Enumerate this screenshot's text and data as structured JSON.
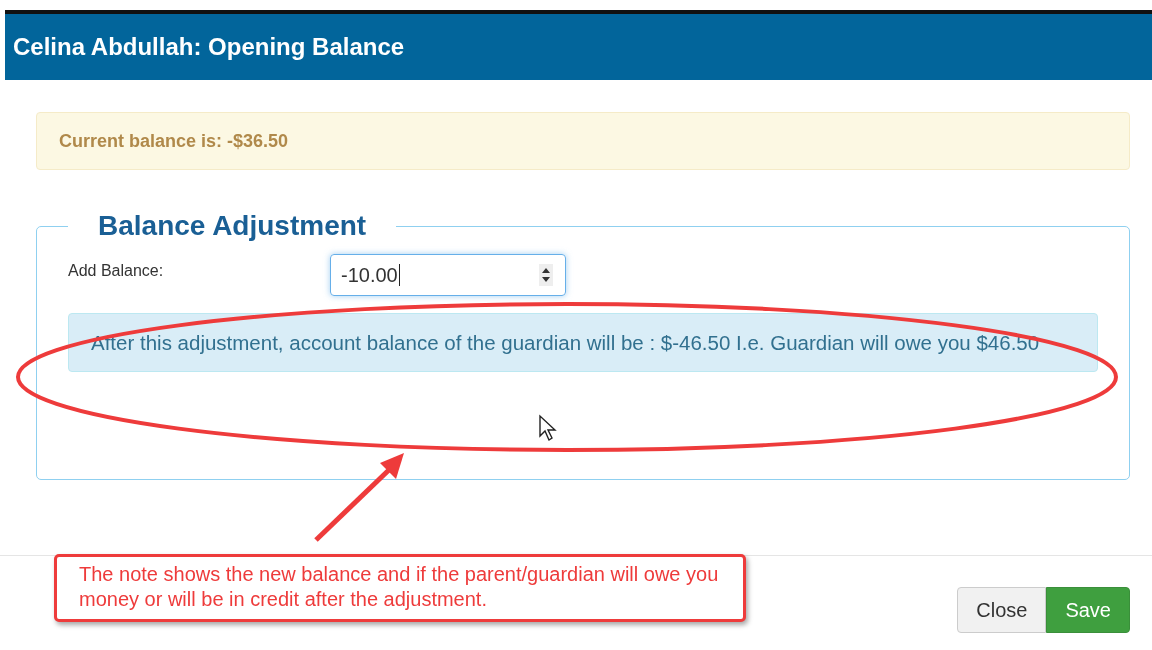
{
  "dialog": {
    "title": "Celina Abdullah: Opening Balance"
  },
  "alert": {
    "text": "Current balance is: -$36.50"
  },
  "fieldset": {
    "legend": "Balance Adjustment",
    "field": {
      "label": "Add Balance:",
      "value": "-10.00"
    },
    "note": "After this adjustment, account balance of the guardian will be : $-46.50 I.e. Guardian will owe you $46.50"
  },
  "buttons": [
    {
      "label": "Close",
      "kind": "default"
    },
    {
      "label": "Save",
      "kind": "primary"
    }
  ],
  "annotation": {
    "text": "The note shows the new balance and if the parent/guardian will owe you money or will be in credit after the adjustment."
  }
}
